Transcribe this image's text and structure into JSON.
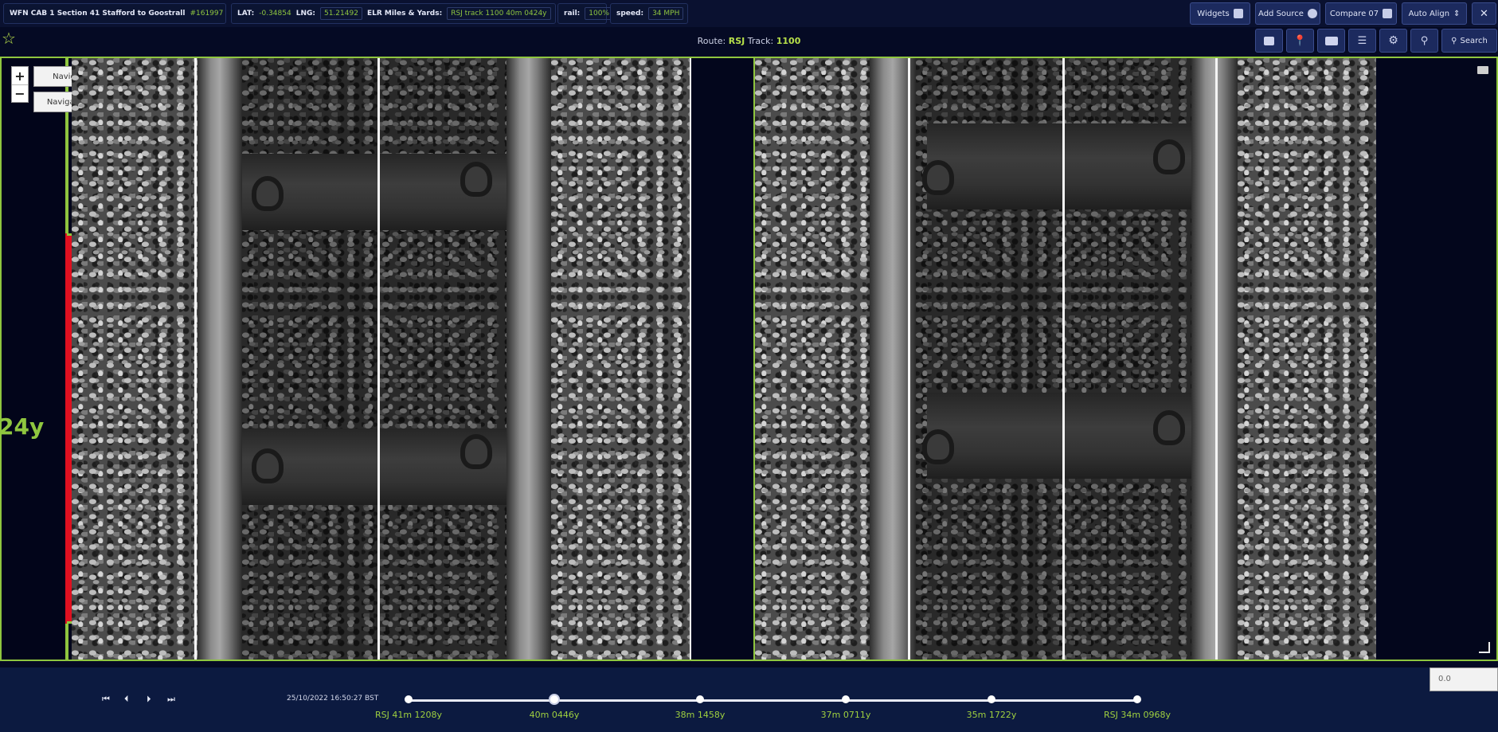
{
  "header": {
    "section": {
      "title": "WFN CAB 1 Section 41 Stafford to Goostrall",
      "id": "#161997"
    },
    "coords": {
      "lat_label": "LAT:",
      "lat_value": "-0.34854",
      "long_label": "LNG:",
      "long_value": "51.21492",
      "elr_label": "ELR Miles & Yards:",
      "elr_value": "RSJ track 1100 40m 0424y"
    },
    "rail": {
      "label": "rail:",
      "value": "100%"
    },
    "speed": {
      "label": "speed:",
      "value": "34 MPH"
    },
    "buttons": {
      "widgets": "Widgets",
      "add_source": "Add Source",
      "compare": "Compare 07",
      "auto_align": "Auto Align",
      "search": "Search"
    }
  },
  "route": {
    "label": "Route:",
    "route_value": "RSJ",
    "track_label": "Track:",
    "track_value": "1100"
  },
  "viewer": {
    "navigate_up": "Navigate Up",
    "navigate_down": "Navigate Down",
    "zoom_in": "+",
    "zoom_out": "−",
    "yard_marker": "24y"
  },
  "timeline": {
    "timestamp": "25/10/2022  16:50:27  BST",
    "markers": [
      {
        "label": "RSJ 41m 1208y",
        "position": 0.0
      },
      {
        "label": "40m 0446y",
        "position": 0.2
      },
      {
        "label": "38m 1458y",
        "position": 0.4
      },
      {
        "label": "37m 0711y",
        "position": 0.6
      },
      {
        "label": "35m 1722y",
        "position": 0.8
      },
      {
        "label": "RSJ 34m 0968y",
        "position": 1.0
      }
    ],
    "current_position": 0.2,
    "value": "0.0"
  },
  "colors": {
    "accent": "#8fc63f",
    "alert": "#e01020",
    "background": "#050a24"
  }
}
